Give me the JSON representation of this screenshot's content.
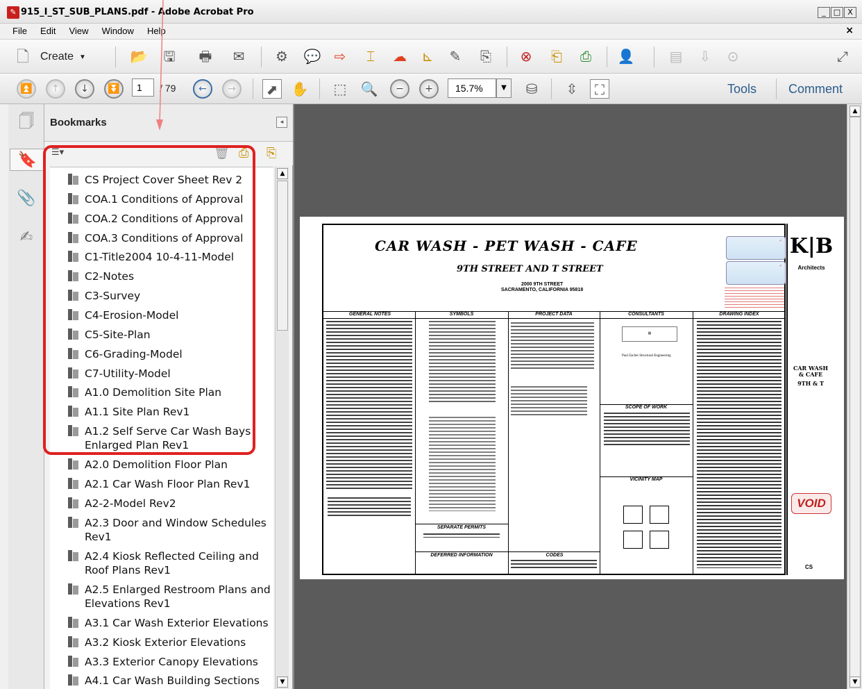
{
  "window": {
    "title": "915_I_ST_SUB_PLANS.pdf - Adobe Acrobat Pro",
    "controls": [
      "_",
      "□",
      "X"
    ]
  },
  "menu": [
    "File",
    "Edit",
    "View",
    "Window",
    "Help"
  ],
  "toolbar": {
    "create_label": "Create",
    "page_current": "1",
    "page_total": "/ 79",
    "zoom": "15.7%",
    "tools_tab": "Tools",
    "comment_tab": "Comment"
  },
  "bookmarks": {
    "title": "Bookmarks",
    "items": [
      "CS Project Cover Sheet Rev 2",
      "COA.1 Conditions of Approval",
      "COA.2 Conditions of Approval",
      "COA.3 Conditions of Approval",
      "C1-Title2004 10-4-11-Model",
      "C2-Notes",
      "C3-Survey",
      "C4-Erosion-Model",
      "C5-Site-Plan",
      "C6-Grading-Model",
      "C7-Utility-Model",
      "A1.0 Demolition Site Plan",
      "A1.1 Site Plan Rev1",
      "A1.2 Self Serve Car Wash Bays Enlarged Plan Rev1",
      "A2.0 Demolition Floor Plan",
      "A2.1 Car Wash Floor Plan Rev1",
      "A2-2-Model Rev2",
      "A2.3 Door and Window Schedules Rev1",
      "A2.4 Kiosk Reflected Ceiling and Roof Plans Rev1",
      "A2.5 Enlarged Restroom Plans and Elevations Rev1",
      "A3.1 Car Wash Exterior Elevations",
      "A3.2 Kiosk Exterior Elevations",
      "A3.3 Exterior Canopy Elevations",
      "A4.1 Car Wash Building Sections"
    ]
  },
  "document": {
    "heading": "CAR WASH  - PET WASH - CAFE",
    "subheading": "9TH STREET AND T STREET",
    "address_line1": "2000 9TH STREET",
    "address_line2": "SACRAMENTO, CALIFORNIA 95818",
    "sections": {
      "general_notes": "GENERAL NOTES",
      "symbols": "SYMBOLS",
      "project_data": "PROJECT DATA",
      "consultants": "CONSULTANTS",
      "drawing_index": "DRAWING INDEX",
      "scope_of_work": "SCOPE OF WORK",
      "vicinity_map": "VICINITY MAP",
      "separate_permits": "SEPARATE PERMITS",
      "deferred_information": "DEFERRED INFORMATION",
      "codes": "CODES"
    },
    "consultant_name": "Paul Zacher Structural Engineering",
    "firm_sub": "Architects",
    "sheet_title": "CAR WASH & CAFE",
    "sheet_street": "9TH & T",
    "void_stamp": "VOID",
    "sheet_number": "CS"
  }
}
